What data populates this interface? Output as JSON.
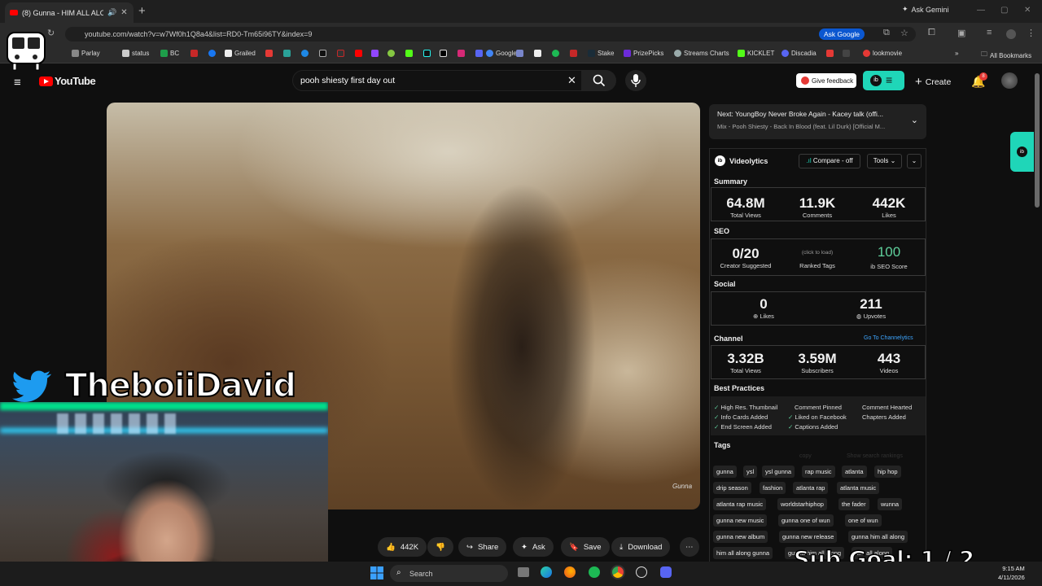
{
  "browser": {
    "tab_title": "(8) Gunna - HIM ALL ALON",
    "url": "youtube.com/watch?v=w7Wf0h1Q8a4&list=RD0-Tm65i96TY&index=9",
    "ask_gemini": "Ask Gemini",
    "ask_google": "Ask Google",
    "bookmarks": [
      "Parlay",
      "status",
      "BC",
      "Grailed",
      "Google",
      "Stake",
      "PrizePicks",
      "Streams Charts",
      "KICKLET",
      "Discadia",
      "lookmovie"
    ],
    "all_bookmarks": "All Bookmarks"
  },
  "youtube": {
    "logo": "YouTube",
    "search_value": "pooh shiesty first day out",
    "feedback": "Give feedback",
    "create": "Create",
    "notifications": "8"
  },
  "video": {
    "watermark": "Gunna"
  },
  "actions": {
    "likes": "442K",
    "share": "Share",
    "ask": "Ask",
    "save": "Save",
    "download": "Download"
  },
  "next": {
    "title": "Next: YoungBoy Never Broke Again - Kacey talk (offi...",
    "mix": "Mix - Pooh Shiesty - Back In Blood (feat. Lil Durk) [Official M..."
  },
  "videolytics": {
    "title": "Videolytics",
    "compare": "Compare - off",
    "tools": "Tools",
    "summary": "Summary",
    "views": "64.8M",
    "views_label": "Total Views",
    "comments": "11.9K",
    "comments_label": "Comments",
    "likes": "442K",
    "likes_label": "Likes",
    "seo": "SEO",
    "creator": "0/20",
    "creator_label": "Creator Suggested",
    "click_load": "(click to load)",
    "ranked_label": "Ranked Tags",
    "seo_score": "100",
    "seo_score_label": "SEO Score",
    "social": "Social",
    "soc_likes": "0",
    "soc_likes_label": "Likes",
    "upvotes": "211",
    "upvotes_label": "Upvotes",
    "channel": "Channel",
    "go_channel": "Go To Channelytics",
    "ch_views": "3.32B",
    "ch_views_label": "Total Views",
    "subs": "3.59M",
    "subs_label": "Subscribers",
    "videos": "443",
    "videos_label": "Videos",
    "best_practices": "Best Practices",
    "bp": [
      "High Res. Thumbnail",
      "Comment Pinned",
      "Comment Hearted",
      "Info Cards Added",
      "Liked on Facebook",
      "Chapters Added",
      "End Screen Added",
      "Captions Added"
    ],
    "tags_hdr": "Tags",
    "copy": "copy",
    "show_rank": "Show search rankings",
    "tags": [
      "gunna",
      "ysl",
      "ysl gunna",
      "rap music",
      "atlanta",
      "hip hop",
      "drip season",
      "fashion",
      "atlanta rap",
      "atlanta music",
      "atlanta rap music",
      "worldstarhiphop",
      "the fader",
      "wunna",
      "gunna new music",
      "gunna one of wun",
      "one of wun",
      "gunna new album",
      "gunna new release",
      "gunna him all along",
      "him all along gunna",
      "gunna him all along",
      "him all along"
    ]
  },
  "overlay": {
    "handle": "TheboiiDavid",
    "sub_goal": "Sub Goal:  1 / 2"
  },
  "taskbar": {
    "search": "Search",
    "time": "9:15 AM",
    "date": "4/11/2026"
  }
}
